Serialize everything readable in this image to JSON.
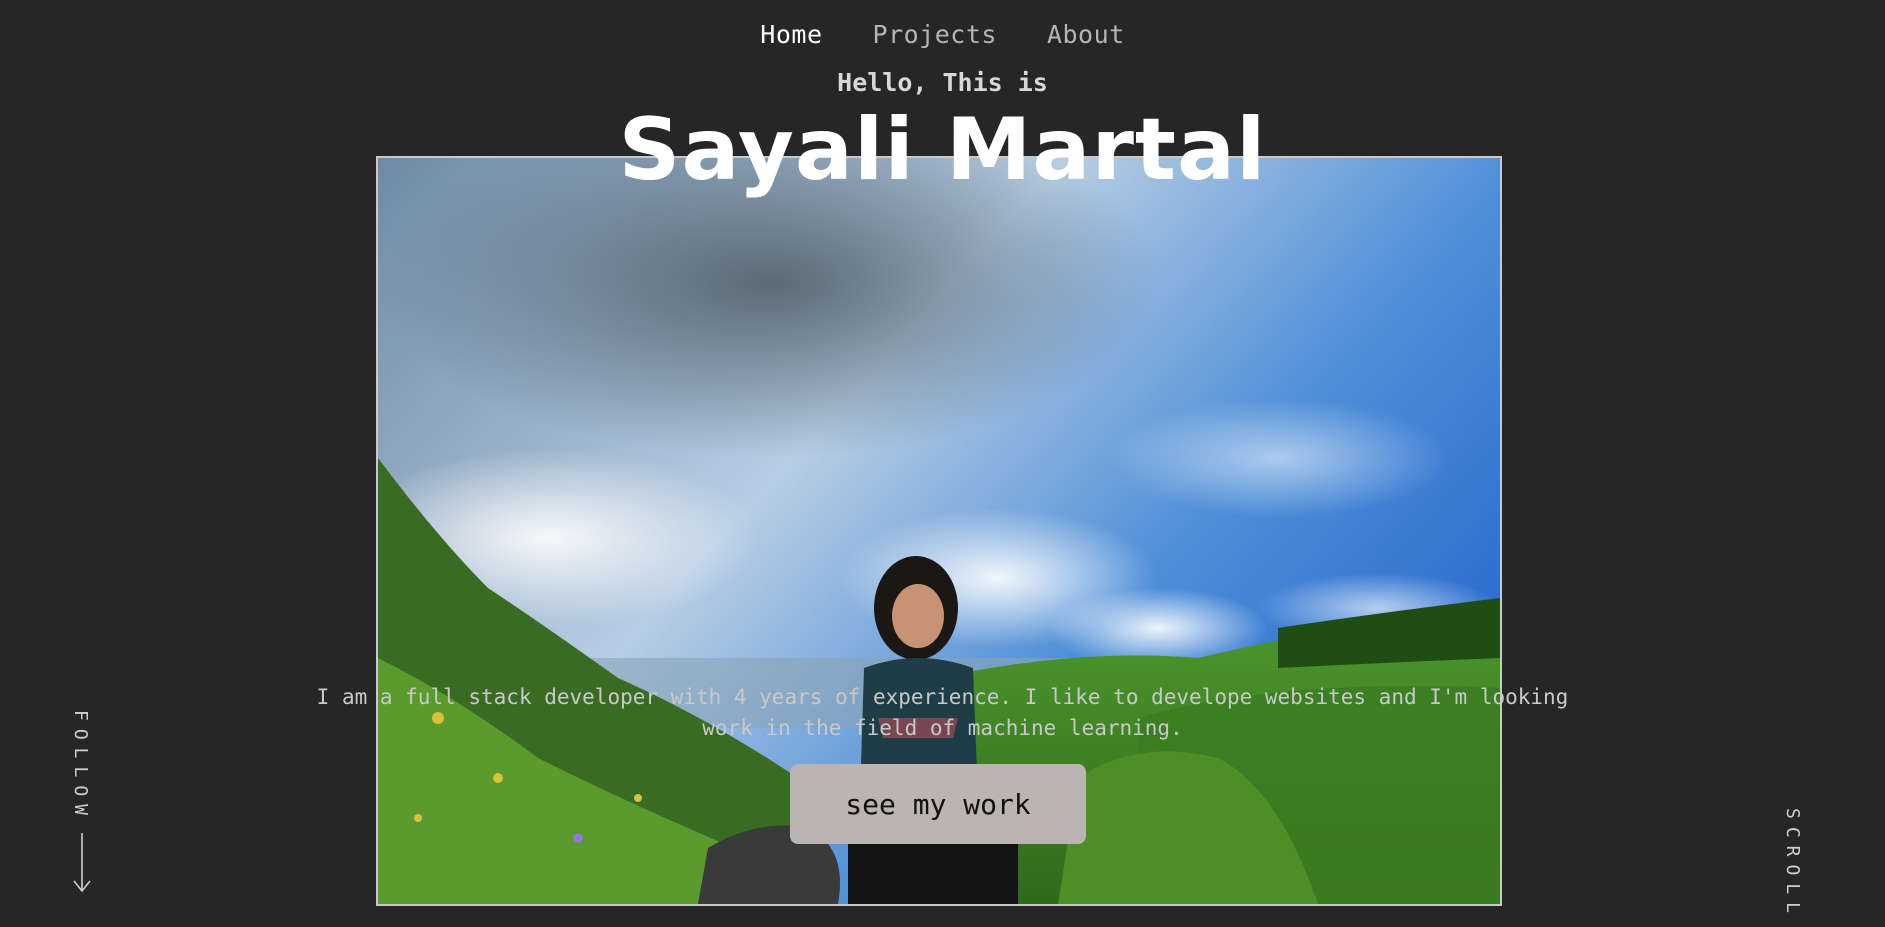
{
  "nav": {
    "items": [
      {
        "label": "Home"
      },
      {
        "label": "Projects"
      },
      {
        "label": "About"
      }
    ]
  },
  "hero": {
    "greeting": "Hello, This is",
    "name": "Sayali Martal",
    "intro_line1": "I am a full stack developer with 4 years of experience. I like to develope websites and I'm looking",
    "intro_line2": "work in the field of machine learning.",
    "cta_label": "see my work"
  },
  "side": {
    "follow_label": "FOLLOW",
    "scroll_label": "SCROLL"
  },
  "colors": {
    "background": "#262626",
    "nav_active": "#ffffff",
    "nav_inactive": "#b5b5b5",
    "button_bg": "#bcb3b3"
  },
  "icons": [
    "arrow-down-icon"
  ]
}
